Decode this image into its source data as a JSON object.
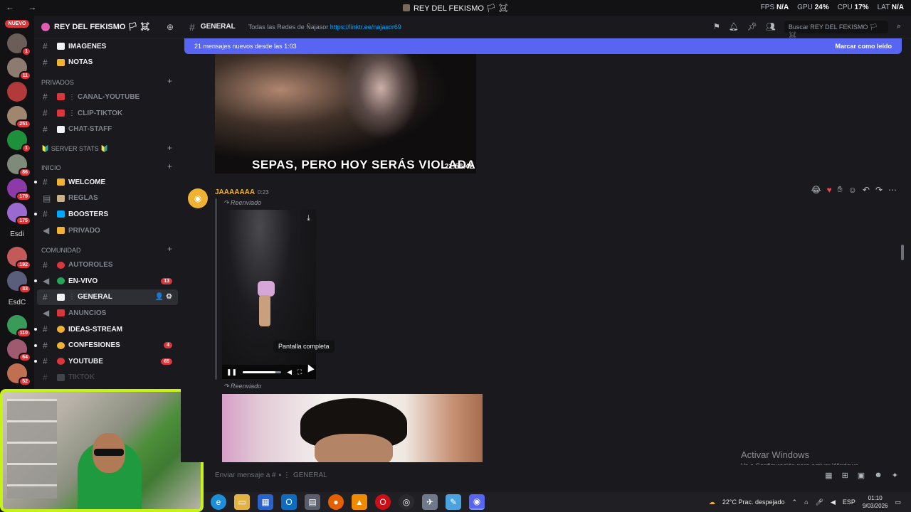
{
  "window": {
    "title": "REY DEL FEKISMO 🏳 ☠",
    "nav": "← →"
  },
  "perf": {
    "fps_label": "FPS",
    "fps_value": "N/A",
    "gpu_label": "GPU",
    "gpu_value": "24%",
    "cpu_label": "CPU",
    "cpu_value": "17%",
    "lat_label": "LAT",
    "lat_value": "N/A"
  },
  "rail": {
    "nuevo": "NUEVO",
    "badges": [
      "1",
      "11",
      "",
      "251",
      "1",
      "86",
      "179",
      "175"
    ],
    "text_items": [
      "Esdi",
      "EsdC"
    ],
    "badges2": [
      "192",
      "33",
      "110",
      "64",
      "52"
    ]
  },
  "server": {
    "name": "REY DEL FEKISMO 🏳 ☠"
  },
  "channels_top": [
    {
      "name": "IMAGENES",
      "color": "#f2f3f5"
    },
    {
      "name": "NOTAS",
      "color": "#f0b232"
    }
  ],
  "cat_privados": "PRIVADOS",
  "channels_privados": [
    {
      "name": "CANAL-YOUTUBE",
      "color": "#da373c"
    },
    {
      "name": "CLIP-TIKTOK",
      "color": "#da373c"
    },
    {
      "name": "CHAT-STAFF",
      "color": "#f2f3f5"
    }
  ],
  "cat_stats": "🔰 SERVER STATS 🔰",
  "cat_inicio": "INICIO",
  "channels_inicio": [
    {
      "name": "WELCOME",
      "color": "#f0b232",
      "unread": true
    },
    {
      "name": "REGLAS",
      "color": "#c9b18a",
      "unread": false
    },
    {
      "name": "BOOSTERS",
      "color": "#00a8fc",
      "unread": true
    },
    {
      "name": "PRIVADO",
      "color": "#f0b232",
      "unread": false
    }
  ],
  "cat_comunidad": "COMUNIDAD",
  "channels_comunidad": [
    {
      "name": "AUTOROLES",
      "color": "#da373c",
      "count": ""
    },
    {
      "name": "EN-VIVO",
      "color": "#23a55a",
      "count": "13"
    },
    {
      "name": "GENERAL",
      "color": "#f2f3f5",
      "count": ""
    },
    {
      "name": "ANUNCIOS",
      "color": "#da373c",
      "count": ""
    },
    {
      "name": "IDEAS-STREAM",
      "color": "#f0b232",
      "count": ""
    },
    {
      "name": "CONFESIONES",
      "color": "#f0b232",
      "count": "4"
    },
    {
      "name": "YOUTUBE",
      "color": "#da373c",
      "count": "65"
    },
    {
      "name": "TIKTOK",
      "color": "#80848e",
      "count": ""
    }
  ],
  "header": {
    "channel": "GENERAL",
    "topic": "Todas las Redes de Ñajasor",
    "link": "https://linktr.ee/najasor69",
    "search": "Buscar REY DEL FEKISMO 🏳 ☠"
  },
  "newbar": {
    "text": "21 mensajes nuevos desde las 1:03",
    "mark": "Marcar como leído"
  },
  "image1": {
    "caption": "SEPAS, PERO HOY SERÁS VIOLADA",
    "timestamp": "21:56:42"
  },
  "message": {
    "author": "JAAAAAAA",
    "time": "0:23",
    "forwarded": "Reenviado",
    "forwarded2": "Reenviado",
    "tooltip": "Pantalla completa",
    "video_progress": 0.85
  },
  "watermark": {
    "title": "Activar Windows",
    "subtitle": "Ve a Configuración para activar Windows."
  },
  "composer": {
    "placeholder": "Enviar mensaje a #",
    "channel": "GENERAL"
  },
  "taskbar": {
    "weather": "22°C  Prac. despejado",
    "lang": "ESP",
    "time": "01:10",
    "date": "9/03/2026"
  },
  "colors": {
    "accent": "#5865f2",
    "webcam_border": "#c6f215",
    "danger": "#da373c"
  }
}
